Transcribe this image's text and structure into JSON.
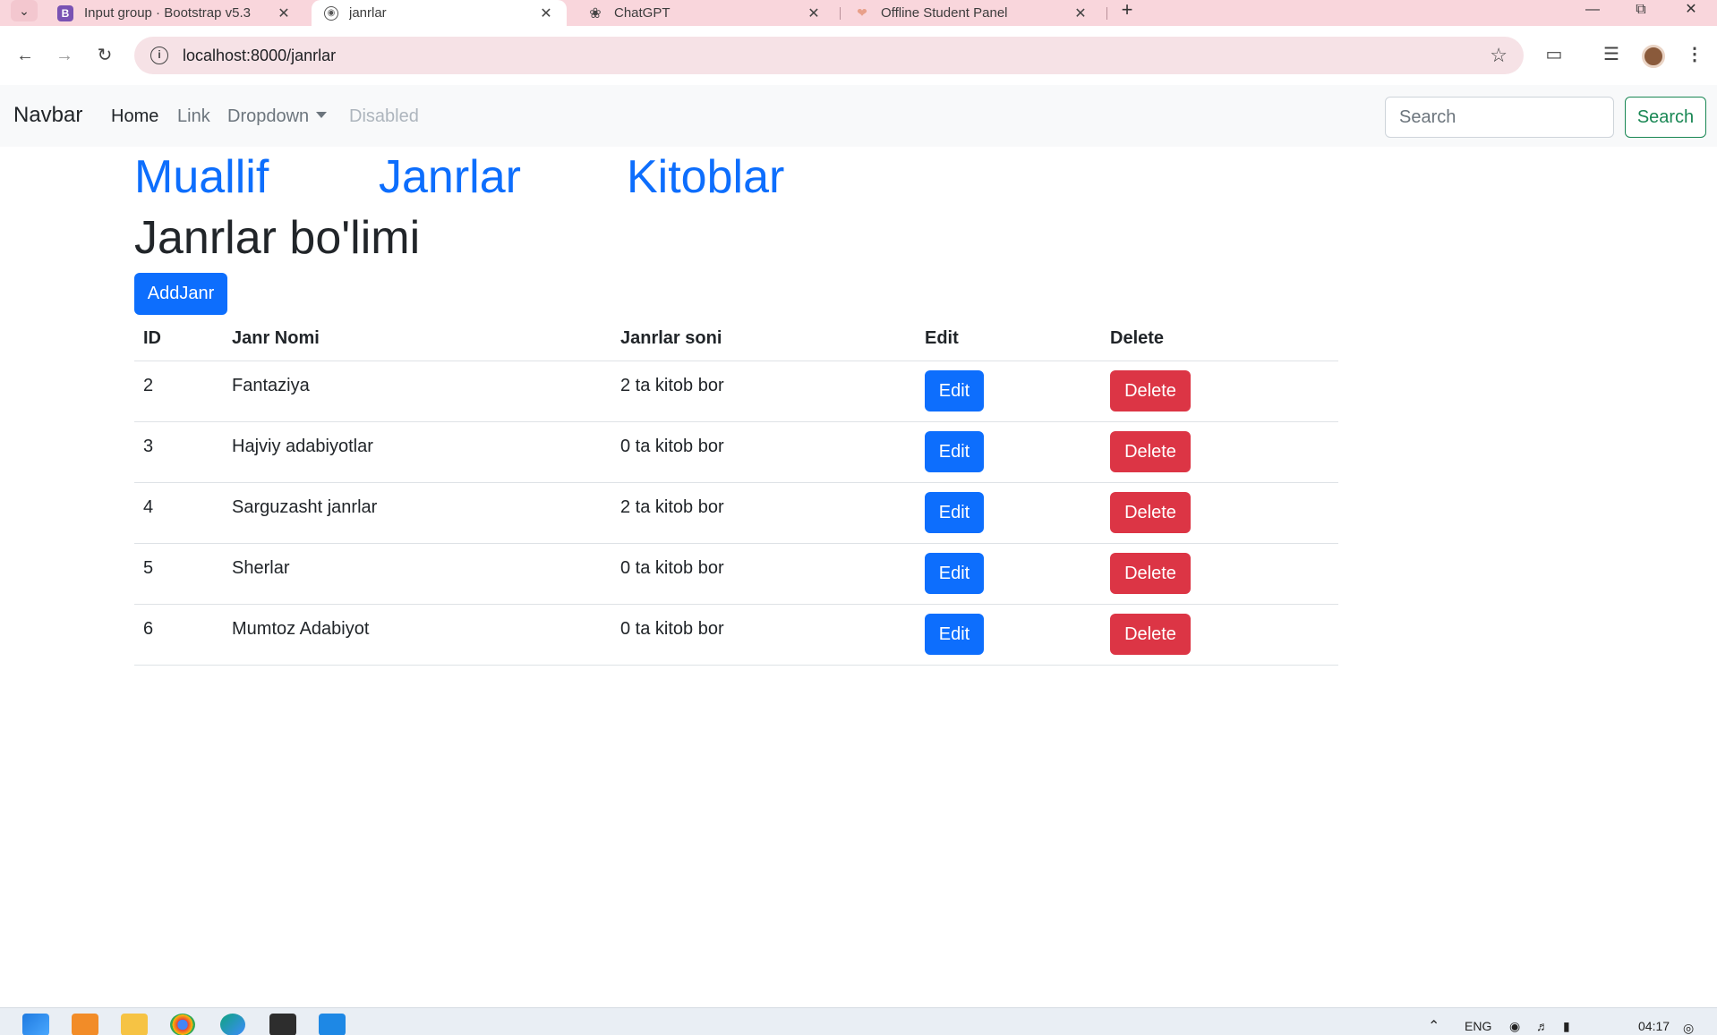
{
  "browser": {
    "tabs": [
      {
        "title": "Input group · Bootstrap v5.3",
        "icon": "bootstrap-icon"
      },
      {
        "title": "janrlar",
        "icon": "globe-icon",
        "active": true
      },
      {
        "title": "ChatGPT",
        "icon": "chatgpt-icon"
      },
      {
        "title": "Offline Student Panel",
        "icon": "student-panel-icon"
      }
    ],
    "new_tab_label": "+",
    "url": "localhost:8000/janrlar"
  },
  "navbar": {
    "brand": "Navbar",
    "links": [
      {
        "label": "Home",
        "state": "active"
      },
      {
        "label": "Link",
        "state": "normal"
      },
      {
        "label": "Dropdown",
        "state": "normal"
      },
      {
        "label": "Disabled",
        "state": "disabled"
      }
    ],
    "search_placeholder": "Search",
    "search_button": "Search"
  },
  "sections": [
    "Muallif",
    "Janrlar",
    "Kitoblar"
  ],
  "page_title": "Janrlar bo'limi",
  "add_button": "AddJanr",
  "table": {
    "headers": [
      "ID",
      "Janr Nomi",
      "Janrlar soni",
      "Edit",
      "Delete"
    ],
    "rows": [
      {
        "id": "2",
        "name": "Fantaziya",
        "count": "2 ta kitob bor",
        "edit": "Edit",
        "delete": "Delete"
      },
      {
        "id": "3",
        "name": "Hajviy adabiyotlar",
        "count": "0 ta kitob bor",
        "edit": "Edit",
        "delete": "Delete"
      },
      {
        "id": "4",
        "name": "Sarguzasht janrlar",
        "count": "2 ta kitob bor",
        "edit": "Edit",
        "delete": "Delete"
      },
      {
        "id": "5",
        "name": "Sherlar",
        "count": "0 ta kitob bor",
        "edit": "Edit",
        "delete": "Delete"
      },
      {
        "id": "6",
        "name": "Mumtoz Adabiyot",
        "count": "0 ta kitob bor",
        "edit": "Edit",
        "delete": "Delete"
      }
    ]
  },
  "taskbar": {
    "language": "ENG",
    "time": "04:17"
  },
  "colors": {
    "primary": "#0d6efd",
    "danger": "#dc3545",
    "success": "#198754",
    "tabbar": "#f9d6dc"
  }
}
